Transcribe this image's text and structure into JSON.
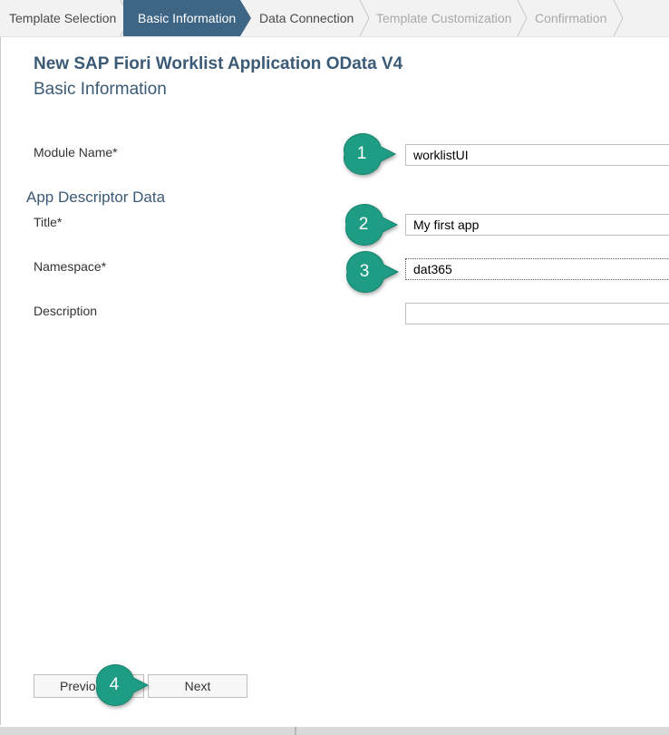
{
  "wizard": {
    "steps": [
      {
        "label": "Template Selection",
        "state": "done"
      },
      {
        "label": "Basic Information",
        "state": "active"
      },
      {
        "label": "Data Connection",
        "state": "done"
      },
      {
        "label": "Template Customization",
        "state": "future"
      },
      {
        "label": "Confirmation",
        "state": "future"
      }
    ]
  },
  "header": {
    "title": "New SAP Fiori Worklist Application OData V4",
    "subtitle": "Basic Information"
  },
  "form": {
    "module_name": {
      "label": "Module Name*",
      "value": "worklistUI"
    },
    "app_descriptor": {
      "section_title": "App Descriptor Data",
      "title": {
        "label": "Title*",
        "value": "My first app"
      },
      "namespace": {
        "label": "Namespace*",
        "value": "dat365"
      },
      "description": {
        "label": "Description",
        "value": ""
      }
    }
  },
  "callouts": [
    "1",
    "2",
    "3",
    "4"
  ],
  "callout_color": "#1f9c84",
  "footer": {
    "previous_label": "Previous",
    "next_label": "Next"
  },
  "colors": {
    "accent": "#3f6585",
    "heading": "#3b5a75"
  }
}
